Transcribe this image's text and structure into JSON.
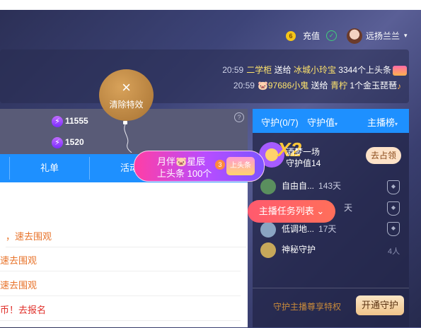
{
  "header": {
    "coin_symbol": "6",
    "recharge_label": "充值",
    "check_symbol": "✓",
    "username": "远扬兰兰",
    "caret": "▾"
  },
  "gift_feed": [
    {
      "time": "20:59",
      "sender": "二学柜",
      "verb": "送给",
      "receiver": "冰城小玲宝",
      "item": "3344个上头条"
    },
    {
      "time": "20:59",
      "sender": "🐷97686小鬼",
      "verb": "送给",
      "receiver": "青柠",
      "item": "1个金玉琵琶"
    }
  ],
  "balloon": {
    "close_symbol": "×",
    "label": "清除特效"
  },
  "stats": [
    {
      "icon": "⚡",
      "value": "11555"
    },
    {
      "icon": "⚡",
      "value": "1520"
    }
  ],
  "help_symbol": "?",
  "left_tabs": [
    "礼单",
    "活动"
  ],
  "messages": [
    {
      "text": "，速去围观",
      "style": "orange"
    },
    {
      "text": "速去围观",
      "style": "orange"
    },
    {
      "text": "速去围观",
      "style": "orange"
    },
    {
      "text": "币！去报名",
      "style": "red"
    }
  ],
  "right_tabs": {
    "guard": "守护(0/7)",
    "guard_value": "守护值",
    "anchor_rank": "主播榜",
    "caret": "▾"
  },
  "top_guard": {
    "name": "酒梦一场",
    "value_label": "守护值14",
    "badge": "X2",
    "action": "去占领"
  },
  "guards": [
    {
      "name": "自由自...",
      "days": "143天",
      "avatar_color": "#5a8f5e"
    },
    {
      "name": "",
      "days": "天",
      "avatar_color": "#7a9ac8"
    },
    {
      "name": "低调地...",
      "days": "17天",
      "avatar_color": "#8aa4c2"
    },
    {
      "name": "神秘守护",
      "days": "",
      "avatar_color": "#c7a85a"
    }
  ],
  "mystery_count": "4人",
  "anchor_task": "主播任务列表",
  "promo_banner": {
    "line1": "月伴🐷星辰",
    "line2": "上头条 100个",
    "circle": "3",
    "badge": "上头条"
  },
  "footer": {
    "privilege": "守护主播尊享特权",
    "open_guard": "开通守护"
  },
  "colors": {
    "tab_blue": "#1e90ff",
    "accent_orange": "#e8732a",
    "accent_red": "#e0302a",
    "gold": "#ffc83a"
  }
}
